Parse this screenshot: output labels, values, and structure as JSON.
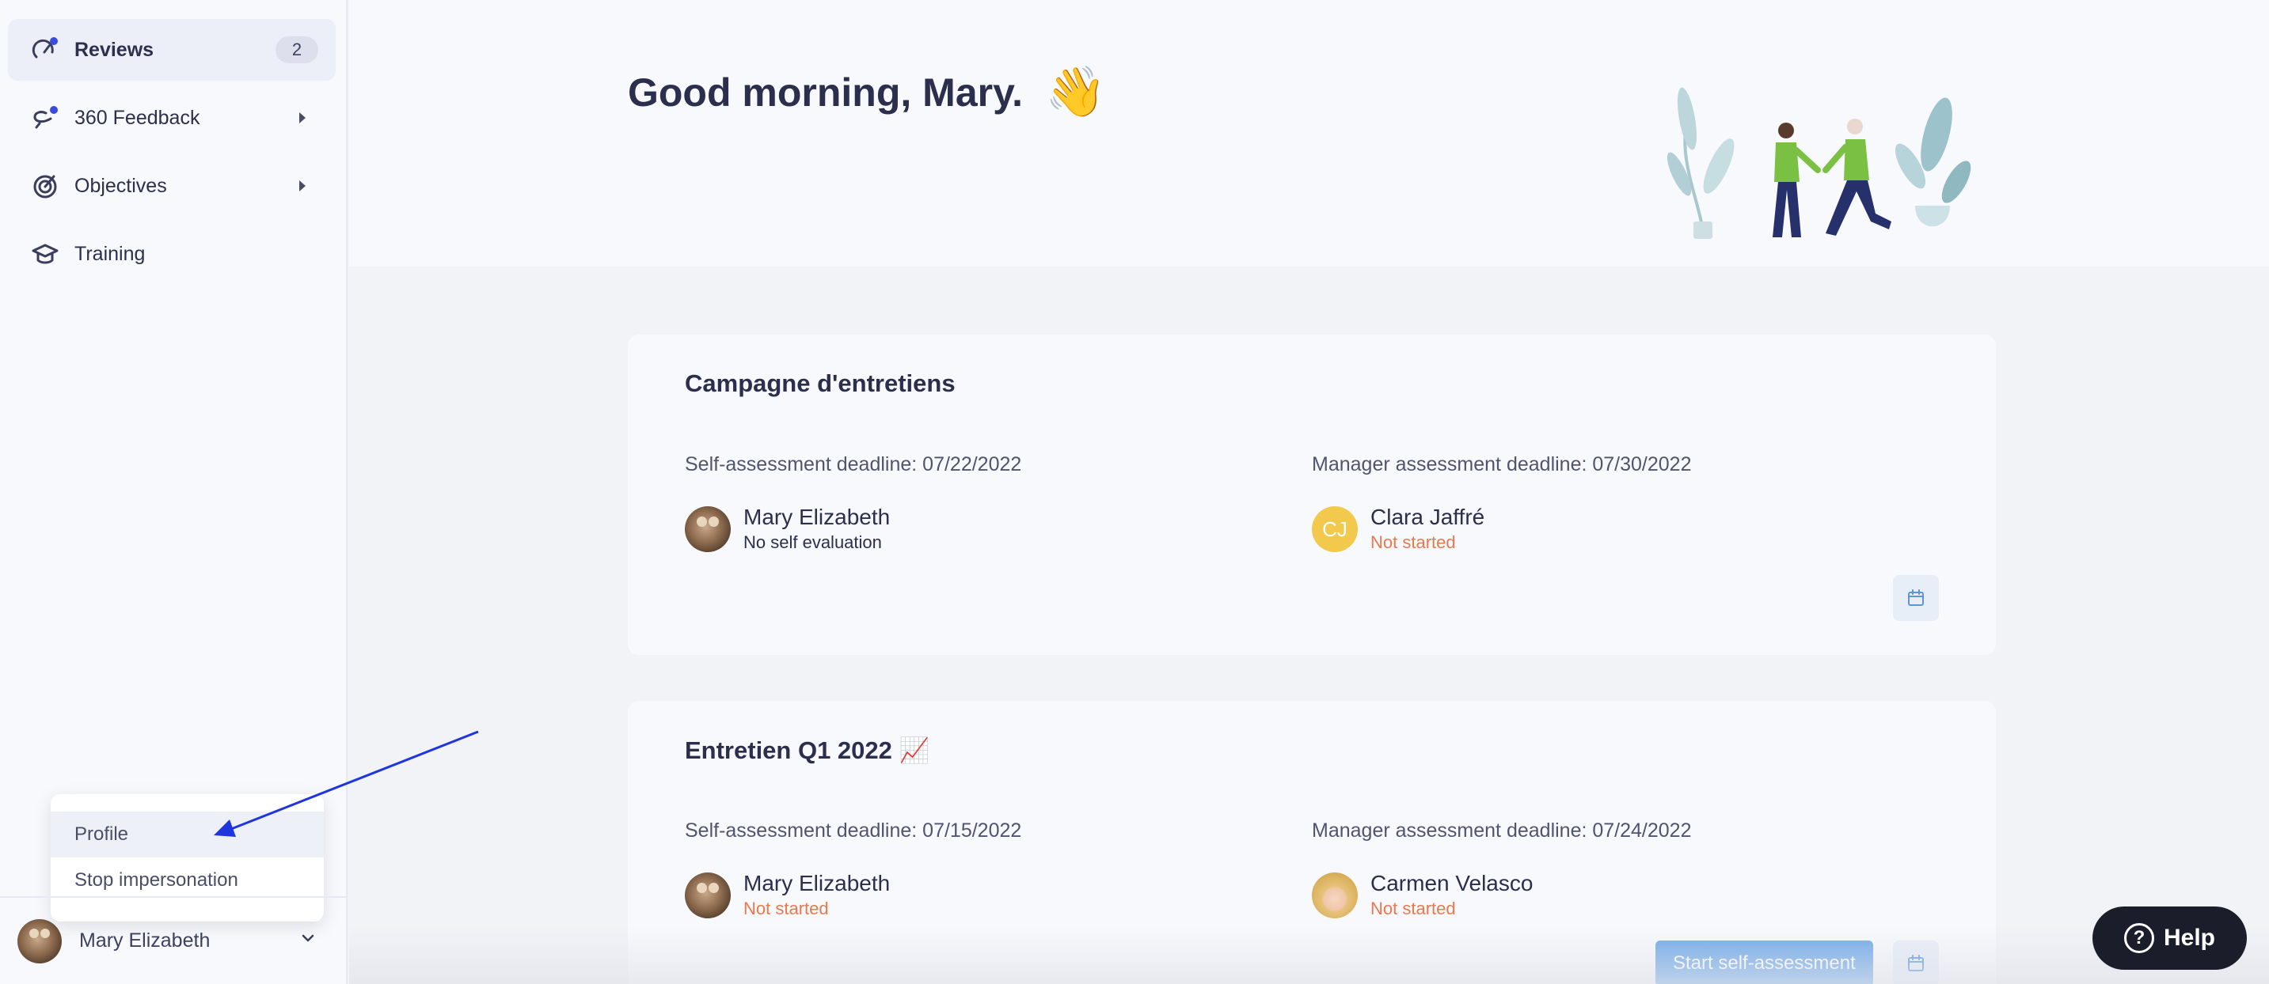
{
  "sidebar": {
    "items": [
      {
        "label": "Reviews",
        "badge": "2",
        "icon": "gauge-icon"
      },
      {
        "label": "360 Feedback",
        "icon": "feedback-loop-icon"
      },
      {
        "label": "Objectives",
        "icon": "target-icon"
      },
      {
        "label": "Training",
        "icon": "graduation-cap-icon"
      }
    ],
    "user_menu": {
      "items": [
        "Profile",
        "Stop impersonation"
      ]
    },
    "footer": {
      "user_name": "Mary Elizabeth",
      "chevron_icon": "chevron-down-icon"
    }
  },
  "hero": {
    "greeting": "Good morning, Mary.",
    "emoji": "👋"
  },
  "cards": [
    {
      "title": "Campagne d'entretiens",
      "self_deadline": "Self-assessment deadline: 07/22/2022",
      "manager_deadline": "Manager assessment deadline: 07/30/2022",
      "employee": {
        "name": "Mary Elizabeth",
        "status": "No self evaluation"
      },
      "manager": {
        "name": "Clara Jaffré",
        "initials": "CJ",
        "status": "Not started"
      }
    },
    {
      "title": "Entretien Q1 2022 📈",
      "self_deadline": "Self-assessment deadline: 07/15/2022",
      "manager_deadline": "Manager assessment deadline: 07/24/2022",
      "employee": {
        "name": "Mary Elizabeth",
        "status": "Not started"
      },
      "manager": {
        "name": "Carmen Velasco",
        "status": "Not started"
      },
      "action_label": "Start self-assessment"
    }
  ],
  "help": {
    "label": "Help",
    "glyph": "?"
  },
  "colors": {
    "accent": "#3b49df",
    "warning_text": "#e8794e",
    "primary_button": "#6ea8e8",
    "initials_avatar": "#f2c94c",
    "annotation_arrow": "#1f35e0"
  }
}
